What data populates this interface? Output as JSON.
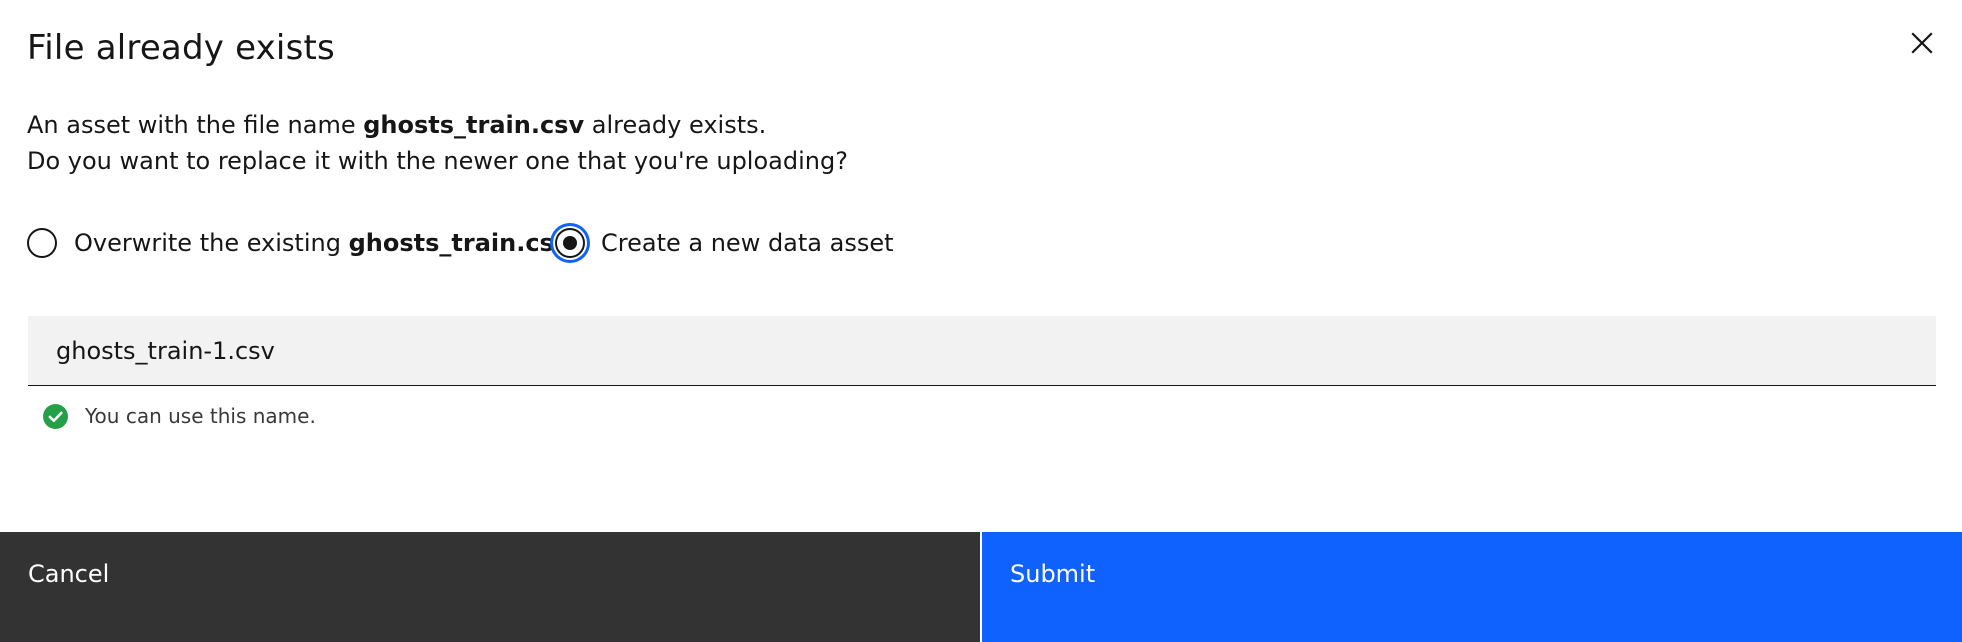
{
  "modal": {
    "title": "File already exists",
    "message": {
      "prefix": "An asset with the file name ",
      "filename": "ghosts_train.csv",
      "suffix": " already exists.",
      "line2": "Do you want to replace it with the newer one that you're uploading?"
    },
    "close_icon": "close-icon"
  },
  "options": {
    "overwrite": {
      "prefix": "Overwrite the existing ",
      "filename": "ghosts_train.csv",
      "selected": false
    },
    "create_new": {
      "label": "Create a new data asset",
      "selected": true
    }
  },
  "name_field": {
    "value": "ghosts_train-1.csv"
  },
  "helper": {
    "text": "You can use this name.",
    "icon": "checkmark-filled-icon",
    "color": "#24a148"
  },
  "footer": {
    "cancel_label": "Cancel",
    "submit_label": "Submit",
    "primary_color": "#0f62fe",
    "secondary_color": "#333333"
  }
}
